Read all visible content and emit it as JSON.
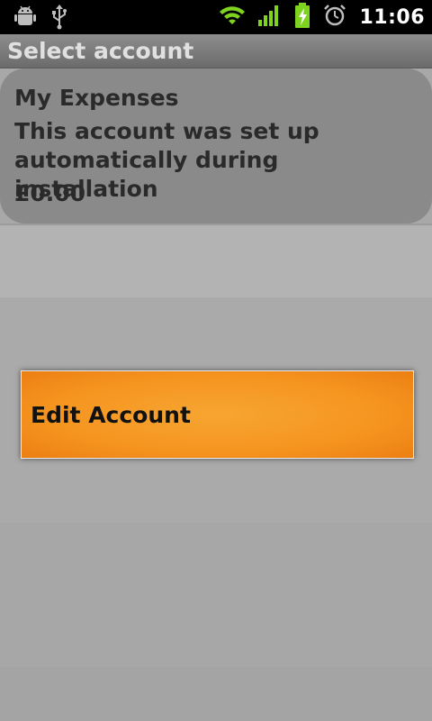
{
  "status_bar": {
    "time": "11:06",
    "icons": [
      "android-debug-icon",
      "usb-icon",
      "wifi-icon",
      "signal-icon",
      "battery-charging-icon",
      "alarm-icon"
    ]
  },
  "title_bar": {
    "title": "Select account"
  },
  "account": {
    "name": "My Expenses",
    "description": "This account was set up automatically during installation",
    "balance": "£0.00"
  },
  "context_menu": {
    "items": [
      {
        "label": "Edit Account"
      }
    ],
    "highlight_color": "#f5951f"
  }
}
